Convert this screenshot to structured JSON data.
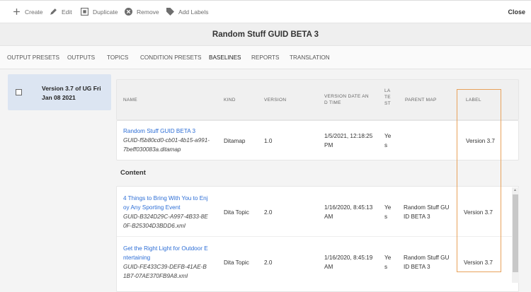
{
  "toolbar": {
    "create": "Create",
    "edit": "Edit",
    "duplicate": "Duplicate",
    "remove": "Remove",
    "add_labels": "Add Labels",
    "close": "Close"
  },
  "title": "Random Stuff GUID BETA 3",
  "tabs": [
    {
      "label": "OUTPUT PRESETS"
    },
    {
      "label": "OUTPUTS"
    },
    {
      "label": "TOPICS"
    },
    {
      "label": "CONDITION PRESETS"
    },
    {
      "label": "BASELINES",
      "active": true
    },
    {
      "label": "REPORTS"
    },
    {
      "label": "TRANSLATION"
    }
  ],
  "baseline": {
    "label": "Version 3.7 of UG Fri Jan 08 2021",
    "checked": false
  },
  "columns": {
    "name": "NAME",
    "kind": "KIND",
    "version": "VERSION",
    "date": "VERSION DATE AND TIME",
    "latest": "LATEST",
    "parent": "PARENT MAP",
    "label": "LABEL"
  },
  "map_row": {
    "title": "Random Stuff GUID BETA 3",
    "guid": "GUID-f5b80cd0-cb01-4b15-a991-7beff030083a.ditamap",
    "kind": "Ditamap",
    "version": "1.0",
    "date": "1/5/2021, 12:18:25 PM",
    "latest": "Yes",
    "parent": "",
    "label": "Version 3.7"
  },
  "content_heading": "Content",
  "content_rows": [
    {
      "title": "4 Things to Bring With You to Enjoy Any Sporting Event",
      "guid": "GUID-B324D29C-A997-4B33-8E0F-B25304D3BDD6.xml",
      "kind": "Dita Topic",
      "version": "2.0",
      "date": "1/16/2020, 8:45:13 AM",
      "latest": "Yes",
      "parent": "Random Stuff GUID BETA 3",
      "label": "Version 3.7"
    },
    {
      "title": "Get the Right Light for Outdoor Entertaining",
      "guid": "GUID-FE433C39-DEFB-41AE-B1B7-07AE370FB9A8.xml",
      "kind": "Dita Topic",
      "version": "2.0",
      "date": "1/16/2020, 8:45:19 AM",
      "latest": "Yes",
      "parent": "Random Stuff GUID BETA 3",
      "label": "Version 3.7"
    }
  ],
  "colors": {
    "link": "#2d6ed6",
    "highlight": "#e8a25b",
    "selected_card": "#dce5f2"
  }
}
